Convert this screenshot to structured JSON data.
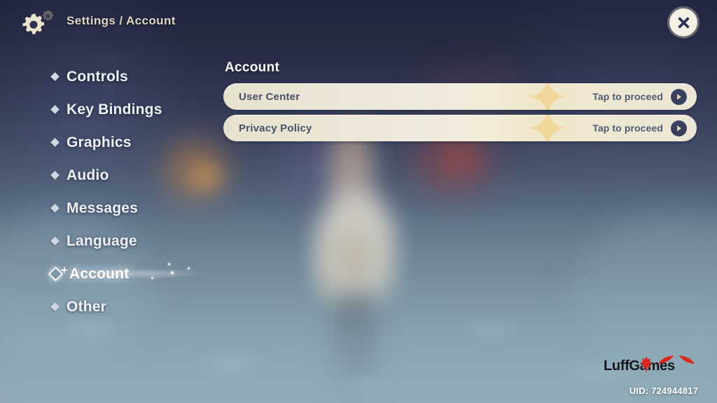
{
  "header": {
    "gear_icon": "gear-icon",
    "breadcrumb": "Settings / Account",
    "close_icon": "close-icon"
  },
  "sidebar": {
    "items": [
      {
        "label": "Controls",
        "selected": false
      },
      {
        "label": "Key Bindings",
        "selected": false
      },
      {
        "label": "Graphics",
        "selected": false
      },
      {
        "label": "Audio",
        "selected": false
      },
      {
        "label": "Messages",
        "selected": false
      },
      {
        "label": "Language",
        "selected": false
      },
      {
        "label": "Account",
        "selected": true
      },
      {
        "label": "Other",
        "selected": false
      }
    ]
  },
  "main": {
    "title": "Account",
    "rows": [
      {
        "label": "User Center",
        "hint": "Tap to proceed",
        "arrow_icon": "chevron-right-icon"
      },
      {
        "label": "Privacy Policy",
        "hint": "Tap to proceed",
        "arrow_icon": "chevron-right-icon"
      }
    ]
  },
  "watermark": {
    "brand": "LuffGames",
    "uid": "UID: 724944817"
  },
  "colors": {
    "row_background": "#efeade",
    "row_text": "#495066",
    "accent_cream": "#ddd6c2",
    "nav_text": "#eef2f6",
    "brand_red": "#d8291f",
    "arrow_circle": "#3a405c"
  }
}
